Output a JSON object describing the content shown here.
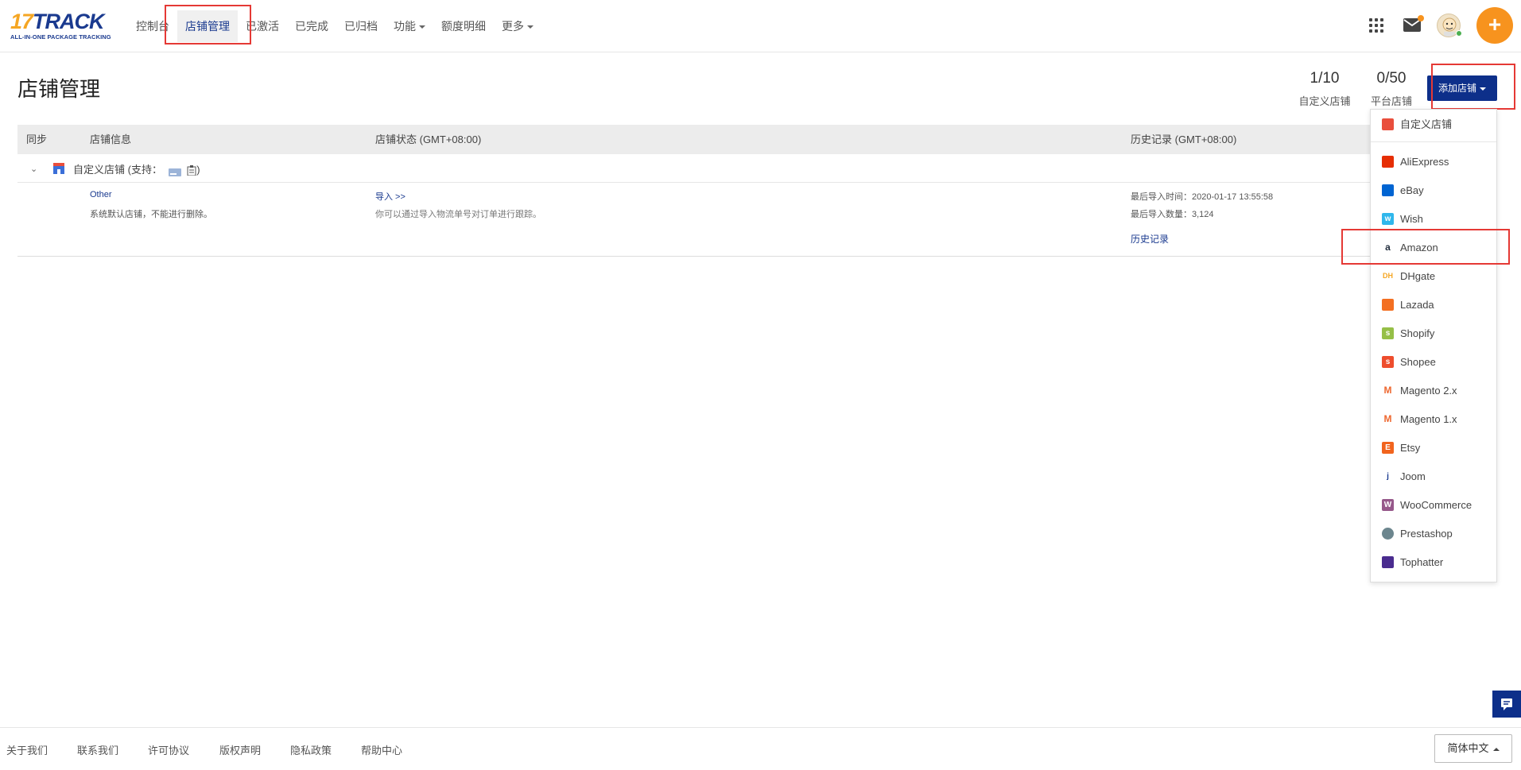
{
  "header": {
    "logo_main_a": "17",
    "logo_main_b": "TRACK",
    "logo_sub": "ALL-IN-ONE PACKAGE TRACKING",
    "nav": [
      "控制台",
      "店铺管理",
      "已激活",
      "已完成",
      "已归档",
      "功能",
      "额度明细",
      "更多"
    ],
    "active_nav": "店铺管理",
    "icons": [
      "apps-grid-icon",
      "mail-icon",
      "avatar",
      "plus-icon"
    ],
    "plus_label": "+"
  },
  "page": {
    "title": "店铺管理",
    "stats": [
      {
        "value": "1/10",
        "label": "自定义店铺"
      },
      {
        "value": "0/50",
        "label": "平台店铺"
      }
    ],
    "add_button": "添加店铺"
  },
  "table": {
    "headers": [
      "同步",
      "店铺信息",
      "店铺状态 (GMT+08:00)",
      "历史记录 (GMT+08:00)"
    ],
    "group_label_prefix": "自定义店铺 (支持：",
    "group_label_suffix": ")",
    "row": {
      "shop_name": "Other",
      "shop_desc": "系统默认店铺，不能进行删除。",
      "import_link": "导入 >>",
      "import_desc": "你可以通过导入物流单号对订单进行跟踪。",
      "last_import_time": "最后导入时间：2020-01-17 13:55:58",
      "last_import_count": "最后导入数量：3,124",
      "history_link": "历史记录"
    }
  },
  "dropdown": {
    "items": [
      {
        "label": "自定义店铺",
        "icon": "custom-shop-icon",
        "color": "#e94e3c"
      },
      {
        "label": "AliExpress",
        "icon": "aliexpress-icon",
        "color": "#e62e04"
      },
      {
        "label": "eBay",
        "icon": "ebay-icon",
        "color": "#0064d2"
      },
      {
        "label": "Wish",
        "icon": "wish-icon",
        "color": "#2fb7ec"
      },
      {
        "label": "Amazon",
        "icon": "amazon-icon",
        "color": "#232f3e"
      },
      {
        "label": "DHgate",
        "icon": "dhgate-icon",
        "color": "#f5a623"
      },
      {
        "label": "Lazada",
        "icon": "lazada-icon",
        "color": "#f36f21"
      },
      {
        "label": "Shopify",
        "icon": "shopify-icon",
        "color": "#95bf47"
      },
      {
        "label": "Shopee",
        "icon": "shopee-icon",
        "color": "#ee4d2d"
      },
      {
        "label": "Magento 2.x",
        "icon": "magento-icon",
        "color": "#ee672f"
      },
      {
        "label": "Magento 1.x",
        "icon": "magento-icon",
        "color": "#ee672f"
      },
      {
        "label": "Etsy",
        "icon": "etsy-icon",
        "color": "#f1641e"
      },
      {
        "label": "Joom",
        "icon": "joom-icon",
        "color": "#1a3a8f"
      },
      {
        "label": "WooCommerce",
        "icon": "woocommerce-icon",
        "color": "#96588a"
      },
      {
        "label": "Prestashop",
        "icon": "prestashop-icon",
        "color": "#6c868e"
      },
      {
        "label": "Tophatter",
        "icon": "tophatter-icon",
        "color": "#4a2c8f"
      }
    ]
  },
  "footer": {
    "links": [
      "关于我们",
      "联系我们",
      "许可协议",
      "版权声明",
      "隐私政策",
      "帮助中心"
    ],
    "language": "简体中文"
  }
}
